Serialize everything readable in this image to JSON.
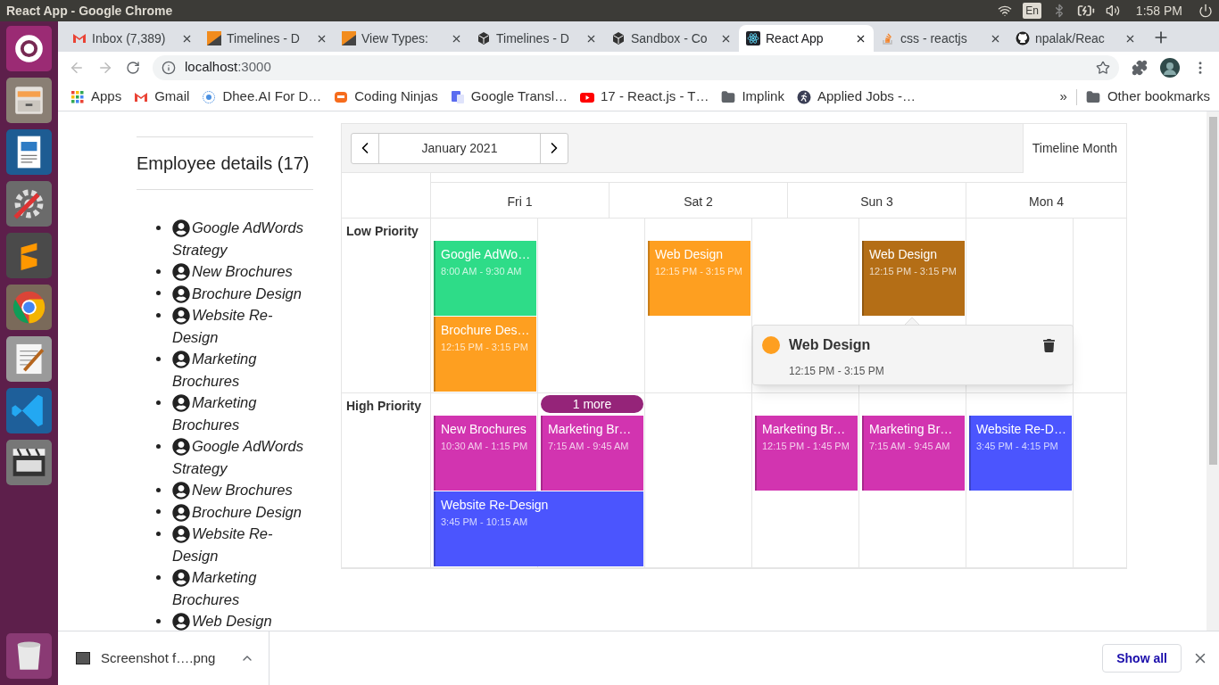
{
  "os_bar": {
    "title": "React App - Google Chrome",
    "keyboard": "En",
    "clock": "1:58 PM"
  },
  "tabs": [
    {
      "label": "Inbox (7,389)",
      "selected": false
    },
    {
      "label": "Timelines - D",
      "selected": false
    },
    {
      "label": "View Types:",
      "selected": false
    },
    {
      "label": "Timelines - D",
      "selected": false
    },
    {
      "label": "Sandbox - Co",
      "selected": false
    },
    {
      "label": "React App",
      "selected": true
    },
    {
      "label": "css - reactjs",
      "selected": false
    },
    {
      "label": "npalak/Reac",
      "selected": false
    }
  ],
  "address": {
    "host": "localhost",
    "port": ":3000"
  },
  "bookmarks": [
    "Apps",
    "Gmail",
    "Dhee.AI For D…",
    "Coding Ninjas",
    "Google Transl…",
    "17 - React.js - T…",
    "Implink",
    "Applied Jobs -…"
  ],
  "bookmarks_more": "»",
  "other_bookmarks": "Other bookmarks",
  "sidebar": {
    "title": "Employee details (17)",
    "items": [
      "Google AdWords Strategy",
      "New Brochures",
      "Brochure Design",
      "Website Re-Design",
      "Marketing Brochures",
      "Marketing Brochures",
      "Google AdWords Strategy",
      "New Brochures",
      "Brochure Design",
      "Website Re-Design",
      "Marketing Brochures",
      "Web Design"
    ]
  },
  "calendar": {
    "period": "January 2021",
    "views": [
      {
        "label": "Timeline Month",
        "selected": true
      }
    ],
    "days": [
      "Fri 1",
      "Sat 2",
      "Sun 3",
      "Mon 4"
    ],
    "resources": [
      {
        "name": "Low Priority",
        "events": [
          {
            "title": "Google AdWo…",
            "time": "8:00 AM - 9:30 AM",
            "color": "#2edc88"
          },
          {
            "title": "Brochure Des…",
            "time": "12:15 PM - 3:15 PM",
            "color": "#fe9f20"
          },
          {
            "title": "Web Design",
            "time": "12:15 PM - 3:15 PM",
            "color": "#fe9f20"
          },
          {
            "title": "Web Design",
            "time": "12:15 PM - 3:15 PM",
            "color": "#b46e16"
          }
        ]
      },
      {
        "name": "High Priority",
        "more": "1 more",
        "events": [
          {
            "title": "New Brochures",
            "time": "10:30 AM - 1:15 PM",
            "color": "#d234b0"
          },
          {
            "title": "Marketing Br…",
            "time": "7:15 AM - 9:45 AM",
            "color": "#d234b0"
          },
          {
            "title": "Marketing Br…",
            "time": "12:15 PM - 1:45 PM",
            "color": "#d234b0"
          },
          {
            "title": "Marketing Br…",
            "time": "7:15 AM - 9:45 AM",
            "color": "#d234b0"
          },
          {
            "title": "Website Re-D…",
            "time": "3:45 PM - 4:15 PM",
            "color": "#4b55fe"
          },
          {
            "title": "Website Re-Design",
            "time": "3:45 PM - 10:15 AM",
            "color": "#4b55fe"
          }
        ]
      }
    ],
    "popover": {
      "title": "Web Design",
      "time": "12:15 PM - 3:15 PM",
      "color": "#fe9f20"
    }
  },
  "downloads": {
    "file": "Screenshot f….png",
    "show_all": "Show all"
  }
}
